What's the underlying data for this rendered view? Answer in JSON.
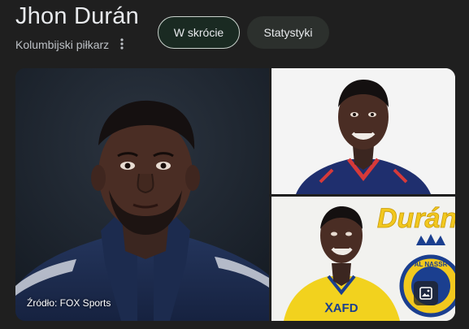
{
  "entity": {
    "title": "Jhon Durán",
    "subtitle": "Kolumbijski piłkarz"
  },
  "tabs": [
    {
      "label": "W skrócie",
      "active": true
    },
    {
      "label": "Statystyki",
      "active": false
    }
  ],
  "gallery": {
    "source_label": "Źródło: FOX Sports",
    "banner_text": "Durán",
    "shirt_text": "ⅩAFD",
    "badge_text": "AL NASSR"
  },
  "colors": {
    "background": "#1f1f1f",
    "text_primary": "#e8eaed",
    "text_secondary": "#bdc1c6",
    "chip_active_bg": "#1a2a22",
    "chip_inactive_bg": "#2c302d",
    "alnassr_yellow": "#f2c81e",
    "alnassr_blue": "#1b3f8f"
  },
  "icons": {
    "more": "more-vert-icon",
    "gallery": "image-gallery-icon"
  }
}
